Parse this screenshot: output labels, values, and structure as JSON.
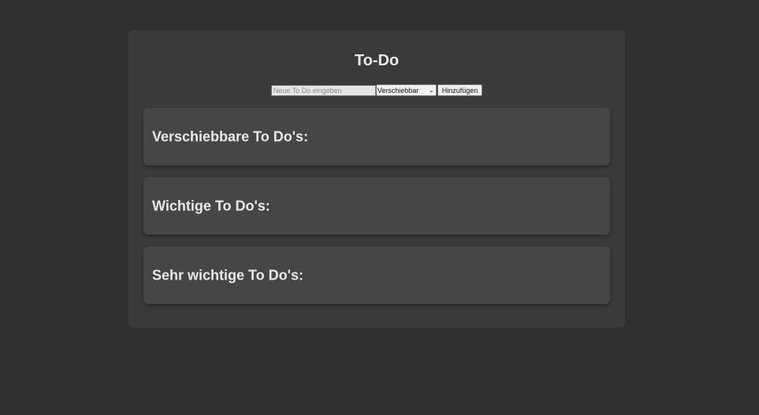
{
  "app": {
    "title": "To-Do"
  },
  "form": {
    "input_placeholder": "Neue To Do eingeben",
    "input_value": "",
    "select_value": "Verschiebbar",
    "add_label": "Hinzufügen"
  },
  "sections": [
    {
      "title": "Verschiebbare To Do's:"
    },
    {
      "title": "Wichtige To Do's:"
    },
    {
      "title": "Sehr wichtige To Do's:"
    }
  ],
  "colors": {
    "page_background": "#2f2f2f",
    "card_background": "#3a3a3a",
    "section_background": "#464646",
    "text": "#e8e8e8"
  }
}
